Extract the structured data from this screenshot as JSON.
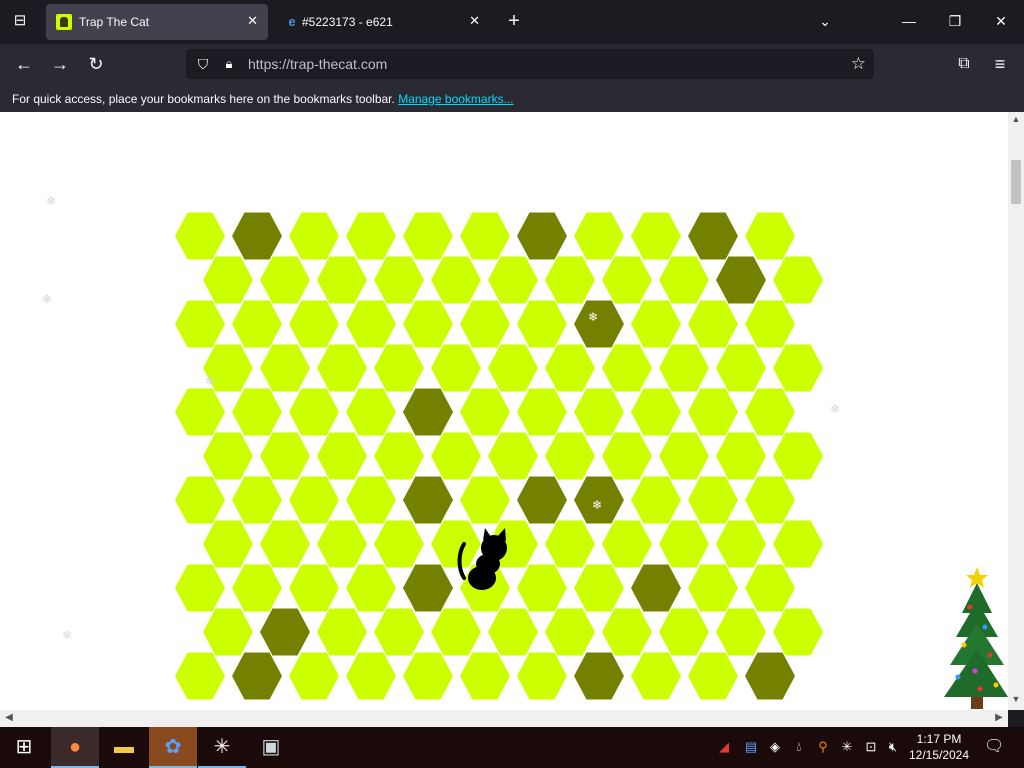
{
  "browser": {
    "tabs": [
      {
        "title": "Trap The Cat",
        "active": true,
        "favicon": "cat-favicon"
      },
      {
        "title": "#5223173 - e621",
        "active": false,
        "favicon": "e621-favicon"
      }
    ],
    "url": "https://trap-thecat.com",
    "bookmarks_bar": {
      "message": "For quick access, place your bookmarks here on the bookmarks toolbar.",
      "link": "Manage bookmarks..."
    }
  },
  "game": {
    "title": "Trap The Cat",
    "colors": {
      "empty": "#ccff00",
      "blocked": "#738000",
      "cat": "#000000"
    },
    "grid": {
      "rows": 11,
      "cols": 11,
      "blocked": [
        [
          0,
          1
        ],
        [
          0,
          6
        ],
        [
          0,
          9
        ],
        [
          1,
          9
        ],
        [
          2,
          7
        ],
        [
          4,
          4
        ],
        [
          6,
          4
        ],
        [
          6,
          6
        ],
        [
          6,
          7
        ],
        [
          8,
          4
        ],
        [
          8,
          8
        ],
        [
          9,
          1
        ],
        [
          10,
          1
        ],
        [
          10,
          7
        ],
        [
          10,
          10
        ]
      ],
      "cat": [
        8,
        5
      ]
    }
  },
  "taskbar": {
    "apps": [
      "start-icon",
      "firefox-icon",
      "file-explorer-icon",
      "app-icon",
      "asterisk-app-icon",
      "photos-icon"
    ],
    "time": "1:17 PM",
    "date": "12/15/2024"
  }
}
